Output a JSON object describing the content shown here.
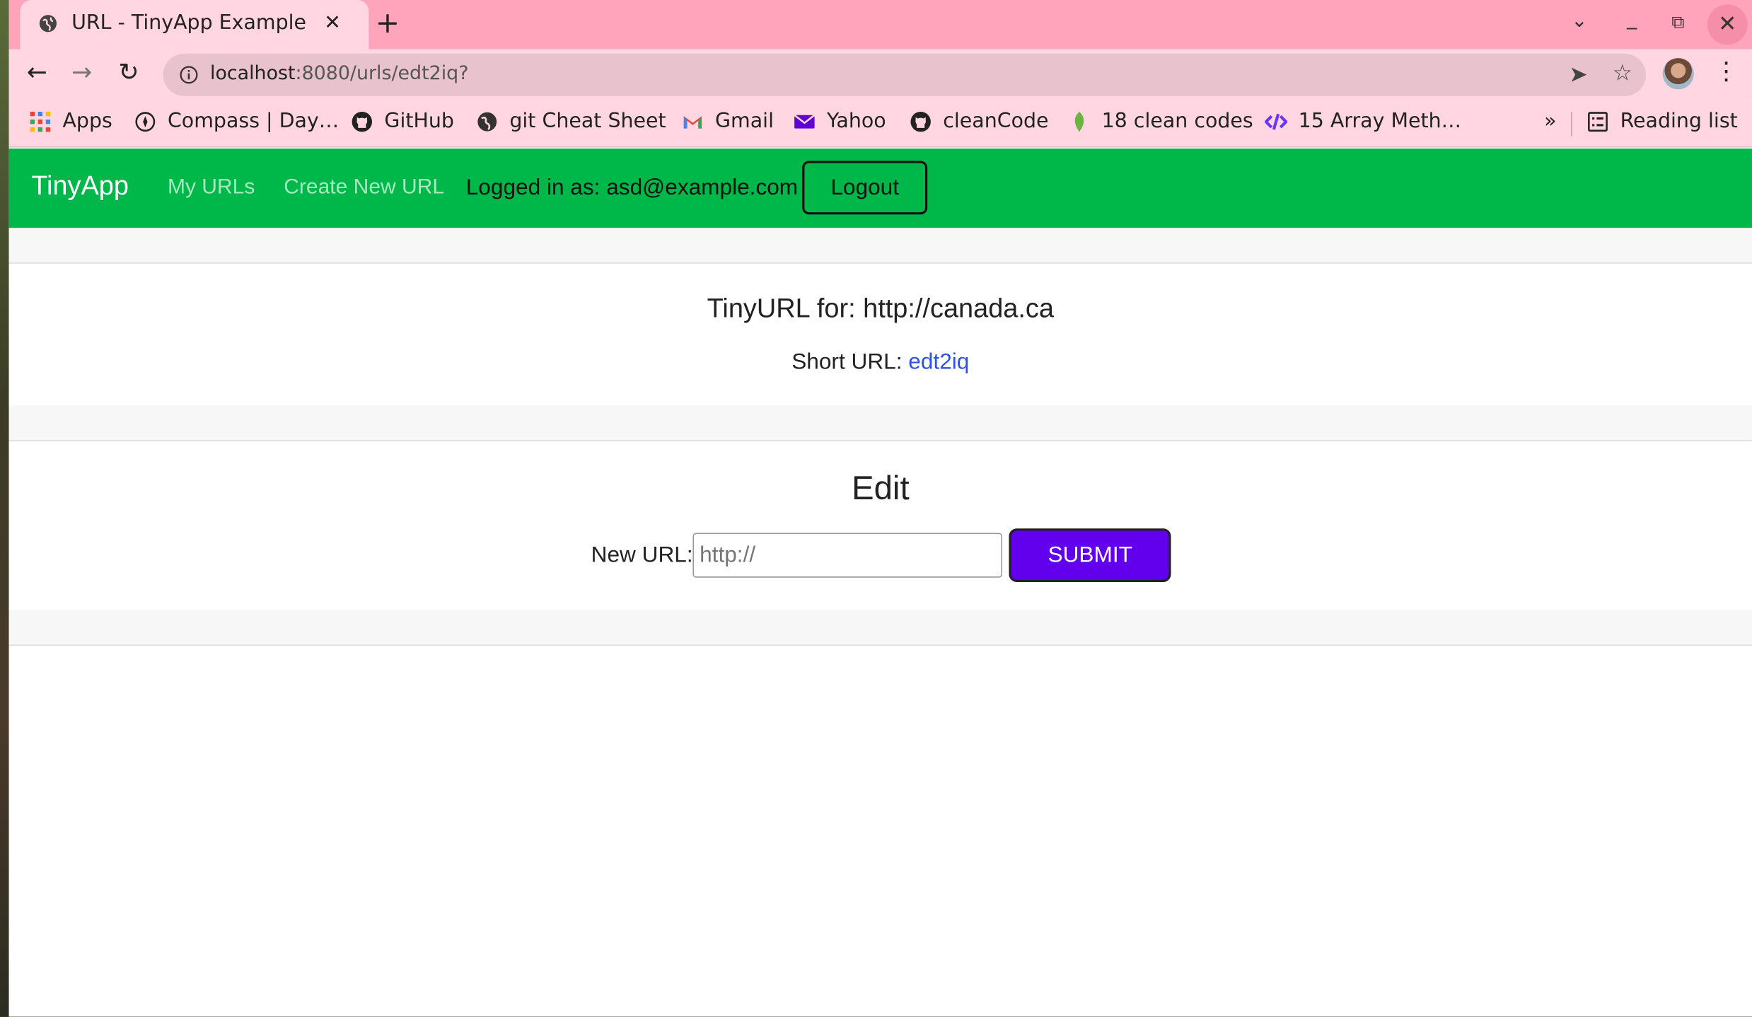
{
  "browser": {
    "tab_title": "URL - TinyApp Example",
    "tab_close": "✕",
    "new_tab": "+",
    "url_host": "localhost",
    "url_rest": ":8080/urls/edt2iq?",
    "bookmarks": [
      {
        "label": "Apps",
        "icon": "apps-grid-icon"
      },
      {
        "label": "Compass | Day…",
        "icon": "compass-icon"
      },
      {
        "label": "GitHub",
        "icon": "github-icon"
      },
      {
        "label": "git Cheat Sheet",
        "icon": "globe-icon"
      },
      {
        "label": "Gmail",
        "icon": "gmail-icon"
      },
      {
        "label": "Yahoo",
        "icon": "yahoo-mail-icon"
      },
      {
        "label": "cleanCode",
        "icon": "github-icon"
      },
      {
        "label": "18 clean codes",
        "icon": "leaf-icon"
      },
      {
        "label": "15 Array Meth…",
        "icon": "code-icon"
      }
    ],
    "bookmarks_overflow": "»",
    "reading_list": "Reading list"
  },
  "app": {
    "brand": "TinyApp",
    "nav": {
      "my_urls": "My URLs",
      "create_new": "Create New URL",
      "logged_in": "Logged in as: asd@example.com",
      "logout": "Logout"
    },
    "detail": {
      "heading": "TinyURL for: http://canada.ca",
      "short_label": "Short URL: ",
      "short_value": "edt2iq"
    },
    "edit": {
      "title": "Edit",
      "label": "New URL:",
      "placeholder": "http://",
      "submit": "SUBMIT"
    }
  },
  "colors": {
    "navbar": "#00b74a",
    "submit": "#6200ee",
    "link": "#2f52e0",
    "tabstrip": "#ffa4bb"
  }
}
